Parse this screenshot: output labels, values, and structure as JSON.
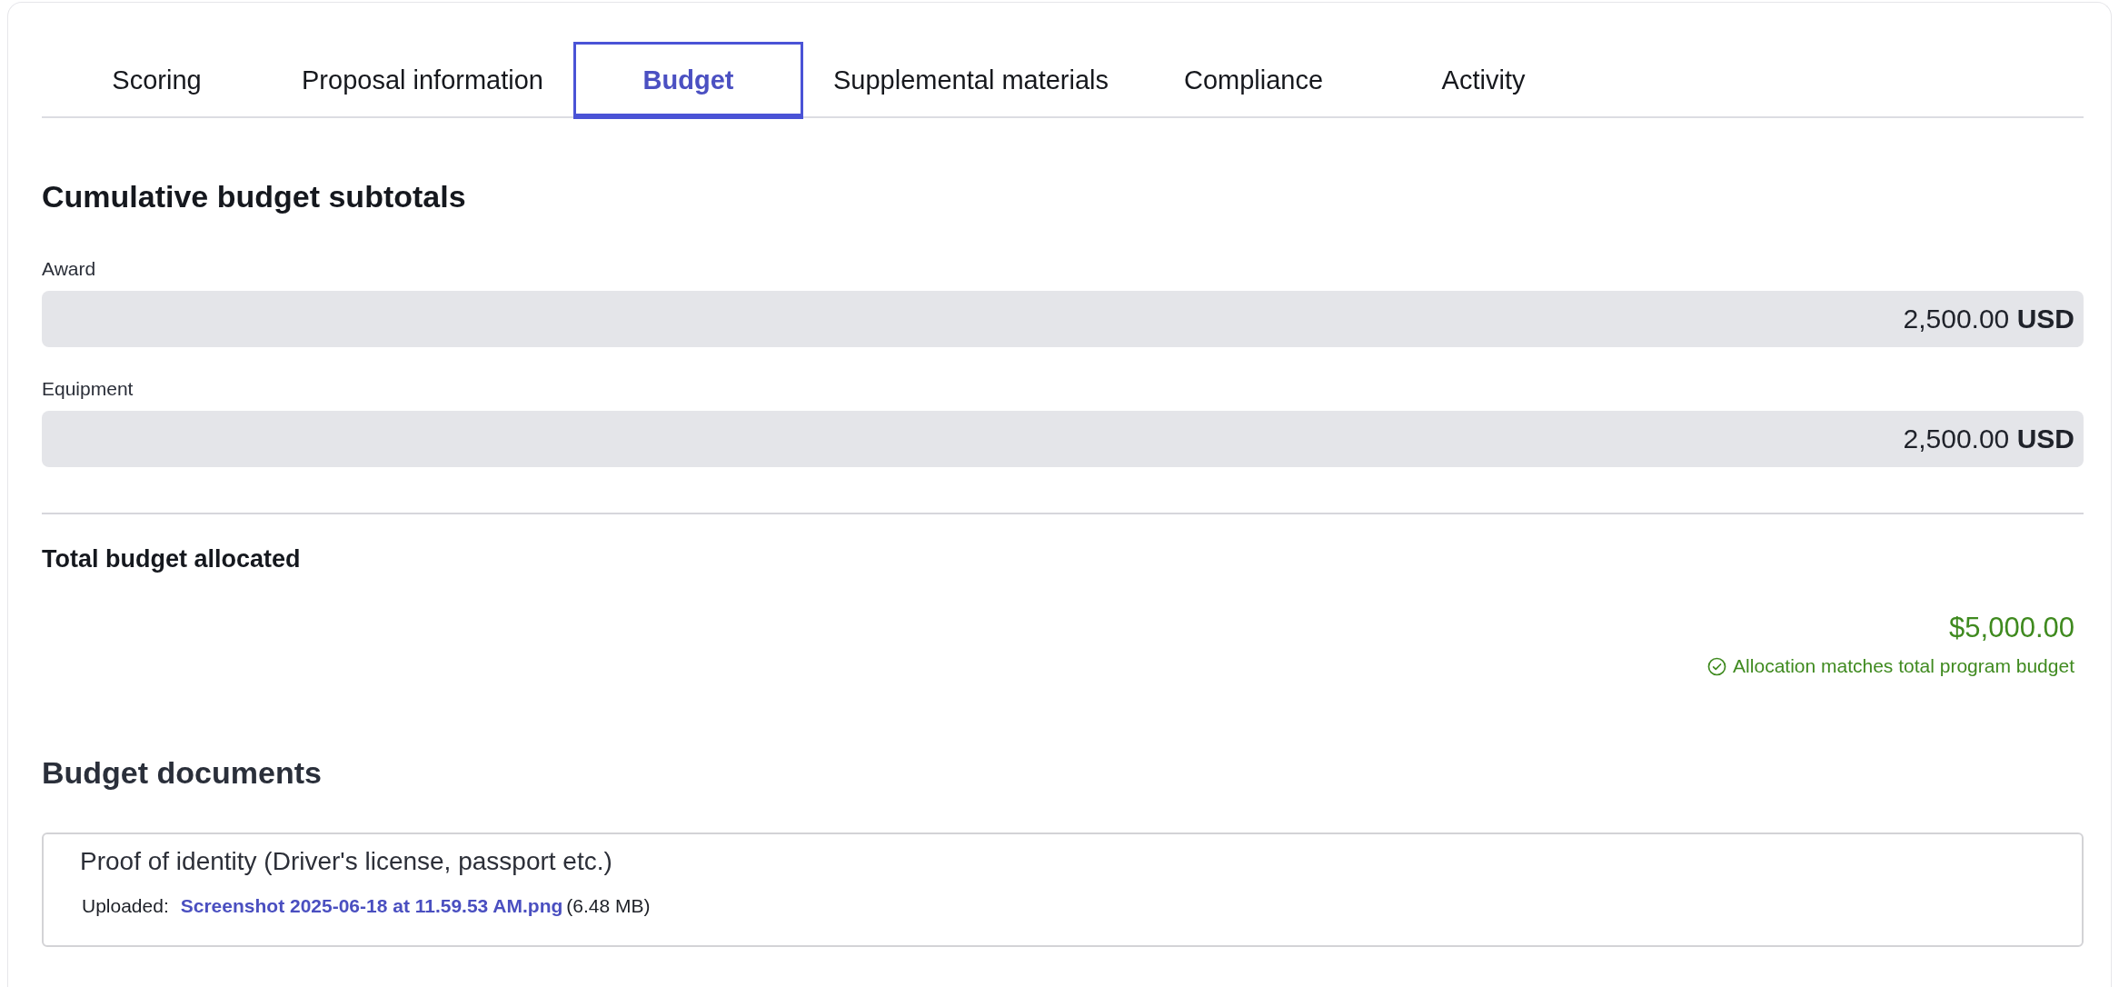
{
  "tabs": [
    {
      "label": "Scoring",
      "selected": false
    },
    {
      "label": "Proposal information",
      "selected": false
    },
    {
      "label": "Budget",
      "selected": true
    },
    {
      "label": "Supplemental materials",
      "selected": false
    },
    {
      "label": "Compliance",
      "selected": false
    },
    {
      "label": "Activity",
      "selected": false
    }
  ],
  "subtotals": {
    "title": "Cumulative budget subtotals",
    "items": [
      {
        "label": "Award",
        "amount": "2,500.00",
        "currency": "USD"
      },
      {
        "label": "Equipment",
        "amount": "2,500.00",
        "currency": "USD"
      }
    ]
  },
  "total": {
    "title": "Total budget allocated",
    "amount": "$5,000.00",
    "matched": true,
    "message": "Allocation matches total program budget"
  },
  "documents": {
    "title": "Budget documents",
    "items": [
      {
        "name": "Proof of identity (Driver's license, passport etc.)",
        "uploaded_label": "Uploaded:",
        "file_name": "Screenshot 2025-06-18 at 11.59.53 AM.png",
        "file_size": "(6.48 MB)"
      }
    ]
  }
}
